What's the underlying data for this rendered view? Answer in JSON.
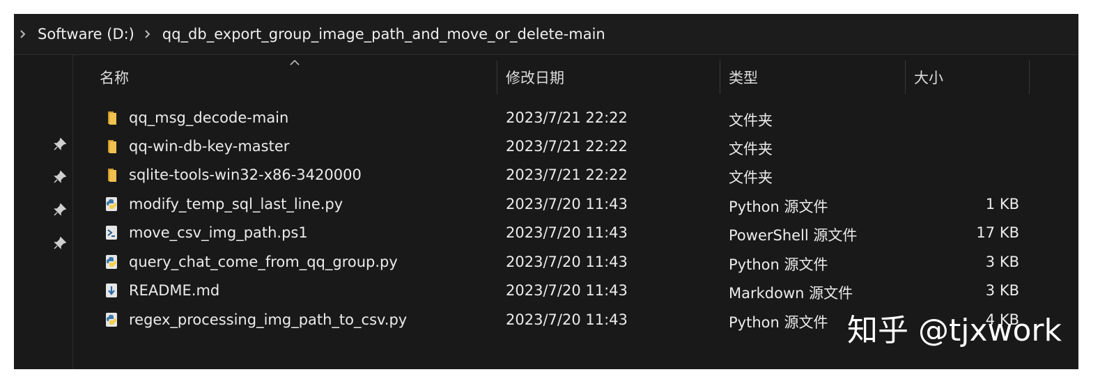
{
  "breadcrumb": {
    "drive": "Software (D:)",
    "folder": "qq_db_export_group_image_path_and_move_or_delete-main"
  },
  "columns": {
    "name": "名称",
    "modified": "修改日期",
    "type": "类型",
    "size": "大小"
  },
  "files": [
    {
      "icon": "folder-icon",
      "name": "qq_msg_decode-main",
      "modified": "2023/7/21 22:22",
      "type": "文件夹",
      "size": ""
    },
    {
      "icon": "folder-icon",
      "name": "qq-win-db-key-master",
      "modified": "2023/7/21 22:22",
      "type": "文件夹",
      "size": ""
    },
    {
      "icon": "folder-icon",
      "name": "sqlite-tools-win32-x86-3420000",
      "modified": "2023/7/21 22:22",
      "type": "文件夹",
      "size": ""
    },
    {
      "icon": "python-file-icon",
      "name": "modify_temp_sql_last_line.py",
      "modified": "2023/7/20 11:43",
      "type": "Python 源文件",
      "size": "1 KB"
    },
    {
      "icon": "powershell-file-icon",
      "name": "move_csv_img_path.ps1",
      "modified": "2023/7/20 11:43",
      "type": "PowerShell 源文件",
      "size": "17 KB"
    },
    {
      "icon": "python-file-icon",
      "name": "query_chat_come_from_qq_group.py",
      "modified": "2023/7/20 11:43",
      "type": "Python 源文件",
      "size": "3 KB"
    },
    {
      "icon": "markdown-file-icon",
      "name": "README.md",
      "modified": "2023/7/20 11:43",
      "type": "Markdown 源文件",
      "size": "3 KB"
    },
    {
      "icon": "python-file-icon",
      "name": "regex_processing_img_path_to_csv.py",
      "modified": "2023/7/20 11:43",
      "type": "Python 源文件",
      "size": "4 KB"
    }
  ],
  "watermark": "知乎 @tjxwork",
  "colors": {
    "background": "#191919",
    "folder": "#e8b84a",
    "python_blue": "#3b77a8",
    "python_yellow": "#f5cf4c",
    "text": "#ececec"
  }
}
